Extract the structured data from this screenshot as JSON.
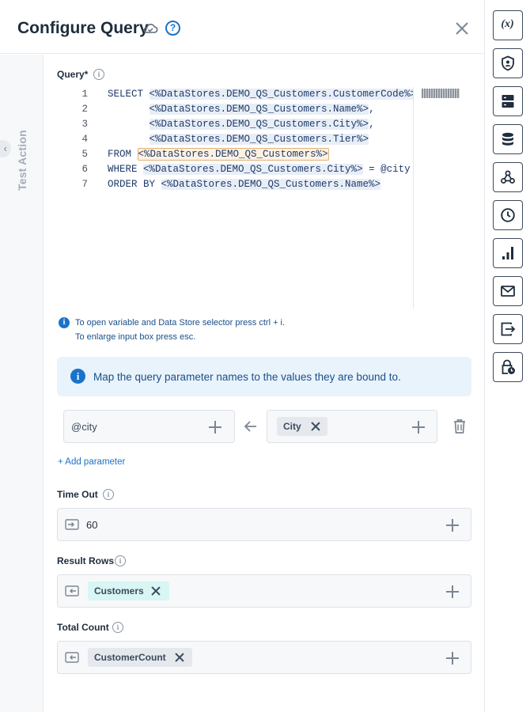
{
  "header": {
    "title": "Configure Query",
    "help_symbol": "?"
  },
  "side": {
    "collapse_symbol": "‹",
    "vertical_label": "Test Action"
  },
  "query": {
    "label": "Query*",
    "line_numbers": [
      "1",
      "2",
      "3",
      "4",
      "5",
      "6",
      "7"
    ],
    "lines": [
      [
        {
          "t": "SELECT "
        },
        {
          "t": "<%DataStores.DEMO_QS_Customers.CustomerCode%>",
          "k": "tok"
        },
        {
          "t": ","
        }
      ],
      [
        {
          "t": "       "
        },
        {
          "t": "<%DataStores.DEMO_QS_Customers.Name%>",
          "k": "tok"
        },
        {
          "t": ","
        }
      ],
      [
        {
          "t": "       "
        },
        {
          "t": "<%DataStores.DEMO_QS_Customers.City%>",
          "k": "tok"
        },
        {
          "t": ","
        }
      ],
      [
        {
          "t": "       "
        },
        {
          "t": "<%DataStores.DEMO_QS_Customers.Tier%>",
          "k": "tok"
        }
      ],
      [
        {
          "t": "FROM "
        },
        {
          "t": "<%DataStores.DEMO_QS_Customers%>",
          "k": "tok-h"
        }
      ],
      [
        {
          "t": "WHERE "
        },
        {
          "t": "<%DataStores.DEMO_QS_Customers.City%>",
          "k": "tok"
        },
        {
          "t": " = @city"
        }
      ],
      [
        {
          "t": "ORDER BY "
        },
        {
          "t": "<%DataStores.DEMO_QS_Customers.Name%>",
          "k": "tok"
        }
      ]
    ],
    "hint_line1": "To open variable and Data Store selector press ctrl + i.",
    "hint_line2": "To enlarge input box press esc."
  },
  "mapping": {
    "banner": "Map the query parameter names to the values they are bound to.",
    "param_name": "@city",
    "bound_chip": "City",
    "add_parameter": "+ Add parameter"
  },
  "timeout": {
    "label": "Time Out",
    "value": "60"
  },
  "result_rows": {
    "label": "Result Rows",
    "chip": "Customers"
  },
  "total_count": {
    "label": "Total Count",
    "chip": "CustomerCount"
  },
  "rail": {
    "variables_symbol": "(x)"
  },
  "colors": {
    "accent": "#1a73c9",
    "banner_bg": "#e9f3fb",
    "highlight_chip": "#d8f6f4"
  }
}
